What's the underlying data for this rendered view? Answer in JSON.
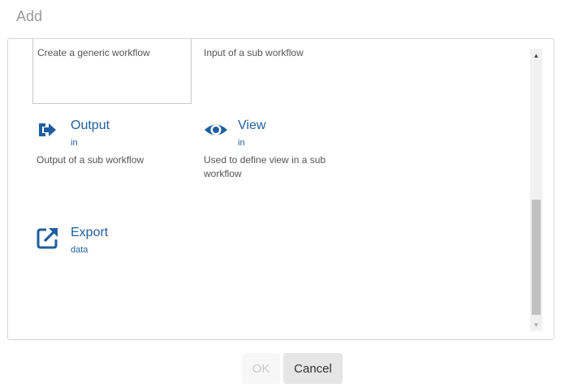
{
  "dialog": {
    "title": "Add"
  },
  "items": [
    {
      "name": "",
      "tag": "",
      "description": "Create a generic workflow",
      "icon": "",
      "selected": true
    },
    {
      "name": "",
      "tag": "",
      "description": "Input of a sub workflow",
      "icon": ""
    },
    {
      "name": "Output",
      "tag": "in",
      "description": "Output of a sub workflow",
      "icon": "sign-out-icon"
    },
    {
      "name": "View",
      "tag": "in",
      "description": "Used to define view in a sub workflow",
      "icon": "eye-icon"
    },
    {
      "name": "Export",
      "tag": "data",
      "description": "",
      "icon": "external-link-icon"
    }
  ],
  "buttons": {
    "ok_label": "OK",
    "cancel_label": "Cancel"
  },
  "colors": {
    "accent": "#1f5e9e",
    "title": "#9a9a9a"
  }
}
